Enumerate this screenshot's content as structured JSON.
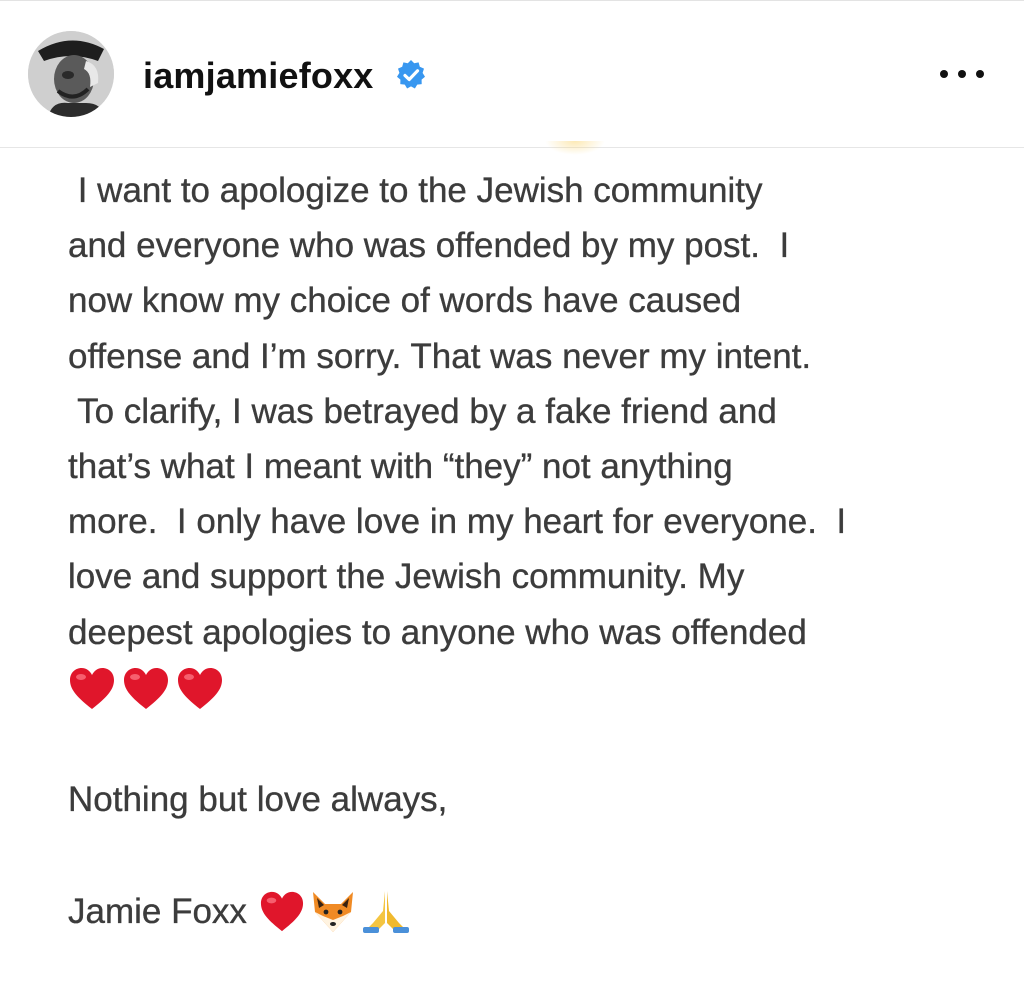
{
  "header": {
    "username": "iamjamiefoxx",
    "verified": true,
    "avatar_icon": "profile-photo",
    "more_icon": "more-horizontal-icon"
  },
  "post": {
    "lines": [
      " I want to apologize to the Jewish community",
      "and everyone who was offended by my post.  I",
      "now know my choice of words have caused",
      "offense and I’m sorry. That was never my intent.",
      " To clarify, I was betrayed by a fake friend and",
      "that’s what I meant with “they” not anything",
      "more.  I only have love in my heart for everyone.  I",
      "love and support the Jewish community. My",
      "deepest apologies to anyone who was offended"
    ],
    "hearts_row": [
      "red-heart",
      "red-heart",
      "red-heart"
    ],
    "signoff": "Nothing but love always,",
    "signature": "Jamie Foxx",
    "signature_emojis": [
      "red-heart",
      "fox-face",
      "folded-hands"
    ]
  },
  "colors": {
    "verified_blue": "#3897f0",
    "heart_red": "#e0162b",
    "text": "#3c3c3c",
    "username": "#111111"
  }
}
